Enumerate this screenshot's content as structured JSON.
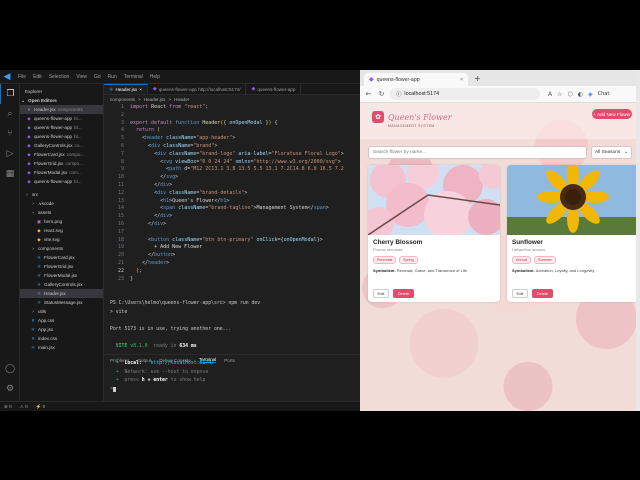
{
  "vscode": {
    "menu": [
      "File",
      "Edit",
      "Selection",
      "View",
      "Go",
      "Run",
      "Terminal",
      "Help"
    ],
    "explorer_title": "Explorer",
    "open_editors_label": "Open Editors",
    "open_editors": [
      {
        "name": "Header.jsx",
        "dim": "components",
        "selected": true
      },
      {
        "name": "queens-flower-app",
        "dim": "bl...",
        "selected": false
      },
      {
        "name": "queens-flower-app",
        "dim": "bl...",
        "selected": false
      },
      {
        "name": "queens-flower-app",
        "dim": "bl...",
        "selected": false
      },
      {
        "name": "GalleryControls.jsx",
        "dim": "co...",
        "selected": false
      },
      {
        "name": "FlowerCard.jsx",
        "dim": "compo...",
        "selected": false
      },
      {
        "name": "FlowerGrid.jsx",
        "dim": "compo...",
        "selected": false
      },
      {
        "name": "FlowerModal.jsx",
        "dim": "com...",
        "selected": false
      },
      {
        "name": "queens-flower-app",
        "dim": "bl...",
        "selected": false
      }
    ],
    "project_tree": [
      {
        "name": "src",
        "type": "folder",
        "indent": 0,
        "selected": false
      },
      {
        "name": ".vscode",
        "type": "folder",
        "indent": 1,
        "selected": false
      },
      {
        "name": "assets",
        "type": "folder",
        "indent": 1,
        "selected": false
      },
      {
        "name": "hero.png",
        "type": "file",
        "indent": 2,
        "selected": false
      },
      {
        "name": "react.svg",
        "type": "file",
        "indent": 2,
        "selected": false
      },
      {
        "name": "vite.svg",
        "type": "file",
        "indent": 2,
        "selected": false
      },
      {
        "name": "components",
        "type": "folder",
        "indent": 1,
        "selected": false
      },
      {
        "name": "FlowerCard.jsx",
        "type": "file",
        "indent": 2,
        "selected": false
      },
      {
        "name": "FlowerGrid.jsx",
        "type": "file",
        "indent": 2,
        "selected": false
      },
      {
        "name": "FlowerModal.jsx",
        "type": "file",
        "indent": 2,
        "selected": false
      },
      {
        "name": "GalleryControls.jsx",
        "type": "file",
        "indent": 2,
        "selected": false
      },
      {
        "name": "Header.jsx",
        "type": "file",
        "indent": 2,
        "selected": true
      },
      {
        "name": "StatusMessage.jsx",
        "type": "file",
        "indent": 2,
        "selected": false
      },
      {
        "name": "utils",
        "type": "folder",
        "indent": 1,
        "selected": false
      },
      {
        "name": "App.css",
        "type": "file",
        "indent": 1,
        "selected": false
      },
      {
        "name": "App.jsx",
        "type": "file",
        "indent": 1,
        "selected": false
      },
      {
        "name": "index.css",
        "type": "file",
        "indent": 1,
        "selected": false
      },
      {
        "name": "main.jsx",
        "type": "file",
        "indent": 1,
        "selected": false
      }
    ],
    "tabs": [
      {
        "label": "Header.jsx",
        "active": true
      },
      {
        "label": "queens-flower-app http://localhost:5174/",
        "active": false
      },
      {
        "label": "queens-flower-app",
        "active": false
      }
    ],
    "breadcrumbs": [
      "components",
      ">",
      "Header.jsx",
      ">",
      "Header"
    ],
    "code_lines": [
      {
        "n": "1",
        "t": [
          [
            "kw",
            "import "
          ],
          [
            "ct",
            "React "
          ],
          [
            "kw",
            "from "
          ],
          [
            "st",
            "\"react\""
          ],
          [
            "ct",
            ";"
          ]
        ]
      },
      {
        "n": "2",
        "t": []
      },
      {
        "n": "3",
        "t": [
          [
            "kw",
            "export default "
          ],
          [
            "kb",
            "function "
          ],
          [
            "fn",
            "Header"
          ],
          [
            "br",
            "("
          ],
          [
            "ct",
            "{ "
          ],
          [
            "at",
            "onOpenModal"
          ],
          [
            "ct",
            " }"
          ],
          [
            "br",
            ")"
          ],
          [
            "ct",
            " {"
          ]
        ]
      },
      {
        "n": "4",
        "t": [
          [
            "ct",
            "  "
          ],
          [
            "kw",
            "return "
          ],
          [
            "br",
            "("
          ]
        ]
      },
      {
        "n": "5",
        "t": [
          [
            "ct",
            "    <"
          ],
          [
            "tg",
            "header "
          ],
          [
            "at",
            "className"
          ],
          [
            "ct",
            "="
          ],
          [
            "st",
            "\"app-header\""
          ],
          [
            "ct",
            ">"
          ]
        ]
      },
      {
        "n": "6",
        "t": [
          [
            "ct",
            "      <"
          ],
          [
            "tg",
            "div "
          ],
          [
            "at",
            "className"
          ],
          [
            "ct",
            "="
          ],
          [
            "st",
            "\"brand\""
          ],
          [
            "ct",
            ">"
          ]
        ]
      },
      {
        "n": "7",
        "t": [
          [
            "ct",
            "        <"
          ],
          [
            "tg",
            "div "
          ],
          [
            "at",
            "className"
          ],
          [
            "ct",
            "="
          ],
          [
            "st",
            "\"brand-logo\" "
          ],
          [
            "at",
            "aria-label"
          ],
          [
            "ct",
            "="
          ],
          [
            "st",
            "\"Floratuse Floral Logo\""
          ],
          [
            "ct",
            ">"
          ]
        ]
      },
      {
        "n": "8",
        "t": [
          [
            "ct",
            "          <"
          ],
          [
            "tg",
            "svg "
          ],
          [
            "at",
            "viewBox"
          ],
          [
            "ct",
            "="
          ],
          [
            "st",
            "\"0 0 24 24\" "
          ],
          [
            "at",
            "xmlns"
          ],
          [
            "ct",
            "="
          ],
          [
            "st",
            "\"http://www.w3.org/2000/svg\""
          ],
          [
            "ct",
            ">"
          ]
        ]
      },
      {
        "n": "9",
        "t": [
          [
            "ct",
            "            <"
          ],
          [
            "tg",
            "path "
          ],
          [
            "at",
            "d"
          ],
          [
            "ct",
            "="
          ],
          [
            "st",
            "\"M12 2C13.1 3.8 13.5 5.5 13.1 7.2C14.8 6.0 16.5 7.2"
          ]
        ]
      },
      {
        "n": "10",
        "t": [
          [
            "ct",
            "          </"
          ],
          [
            "tg",
            "svg"
          ],
          [
            "ct",
            ">"
          ]
        ]
      },
      {
        "n": "11",
        "t": [
          [
            "ct",
            "        </"
          ],
          [
            "tg",
            "div"
          ],
          [
            "ct",
            ">"
          ]
        ]
      },
      {
        "n": "12",
        "t": [
          [
            "ct",
            "        <"
          ],
          [
            "tg",
            "div "
          ],
          [
            "at",
            "className"
          ],
          [
            "ct",
            "="
          ],
          [
            "st",
            "\"brand-details\""
          ],
          [
            "ct",
            ">"
          ]
        ]
      },
      {
        "n": "13",
        "t": [
          [
            "ct",
            "          <"
          ],
          [
            "tg",
            "h1"
          ],
          [
            "ct",
            ">"
          ],
          [
            "tx",
            "Queen's Flower"
          ],
          [
            "ct",
            "</"
          ],
          [
            "tg",
            "h1"
          ],
          [
            "ct",
            ">"
          ]
        ]
      },
      {
        "n": "14",
        "t": [
          [
            "ct",
            "          <"
          ],
          [
            "tg",
            "span "
          ],
          [
            "at",
            "className"
          ],
          [
            "ct",
            "="
          ],
          [
            "st",
            "\"brand-tagline\""
          ],
          [
            "ct",
            ">"
          ],
          [
            "tx",
            "Management System"
          ],
          [
            "ct",
            "</"
          ],
          [
            "tg",
            "span"
          ],
          [
            "ct",
            ">"
          ]
        ]
      },
      {
        "n": "15",
        "t": [
          [
            "ct",
            "        </"
          ],
          [
            "tg",
            "div"
          ],
          [
            "ct",
            ">"
          ]
        ]
      },
      {
        "n": "16",
        "t": [
          [
            "ct",
            "      </"
          ],
          [
            "tg",
            "div"
          ],
          [
            "ct",
            ">"
          ]
        ]
      },
      {
        "n": "17",
        "t": []
      },
      {
        "n": "18",
        "t": [
          [
            "ct",
            "      <"
          ],
          [
            "tg",
            "button "
          ],
          [
            "at",
            "className"
          ],
          [
            "ct",
            "="
          ],
          [
            "st",
            "\"btn btn-primary\" "
          ],
          [
            "at",
            "onClick"
          ],
          [
            "ct",
            "={"
          ],
          [
            "at",
            "onOpenModal"
          ],
          [
            "ct",
            "}>"
          ]
        ]
      },
      {
        "n": "19",
        "t": [
          [
            "tx",
            "        + Add New Flower"
          ]
        ]
      },
      {
        "n": "20",
        "t": [
          [
            "ct",
            "      </"
          ],
          [
            "tg",
            "button"
          ],
          [
            "ct",
            ">"
          ]
        ]
      },
      {
        "n": "21",
        "t": [
          [
            "ct",
            "    </"
          ],
          [
            "tg",
            "header"
          ],
          [
            "ct",
            ">"
          ]
        ]
      },
      {
        "n": "22",
        "t": [
          [
            "ct",
            "  "
          ],
          [
            "br",
            ")"
          ],
          [
            "ct",
            ";"
          ]
        ]
      },
      {
        "n": "23",
        "t": [
          [
            "ct",
            "}"
          ]
        ]
      }
    ],
    "panel_tabs": [
      "Problems",
      "Output",
      "Debug Console",
      "Terminal",
      "Ports"
    ],
    "terminal": {
      "prompt": "PS C:\\Users\\helmo\\queens-flower-app\\src> npm run dev",
      "cmd": "> vite",
      "port_msg": "Port 5173 is in use, trying another one...",
      "vite_label": "VITE",
      "vite_version": "v8.1.0",
      "ready_text": "ready in",
      "ready_ms": "634 ms",
      "local_label": "Local:",
      "local_url": "http://localhost:5174/",
      "network_label": "Network:",
      "network_text": "use --host to expose",
      "help_prefix": "press",
      "help_key": "h + enter",
      "help_suffix": "to show help"
    },
    "status_items": [
      "⊗ 0",
      "⚠ 0",
      "⚡ 0"
    ]
  },
  "browser": {
    "tab_title": "queens-flower-app",
    "url": "localhost:5174",
    "copilot_label": "Chat",
    "app": {
      "brand_title": "Queen's Flower",
      "brand_tagline": "MANAGEMENT SYSTEM",
      "add_button": "+ Add New Flower",
      "search_placeholder": "Search flower by name...",
      "season_select": "All Seasons",
      "cards": [
        {
          "name": "Cherry Blossom",
          "scientific": "Prunus serrulata",
          "tags": [
            "Perennial",
            "Spring"
          ],
          "symbolism_label": "Symbolism:",
          "symbolism": "Renewal, Grace, and Transience of Life",
          "edit": "Edit",
          "delete": "Delete"
        },
        {
          "name": "Sunflower",
          "scientific": "Helianthus annuus",
          "tags": [
            "Annual",
            "Summer"
          ],
          "symbolism_label": "Symbolism:",
          "symbolism": "Adoration, Loyalty, and Longevity",
          "edit": "Edit",
          "delete": "Delete"
        }
      ]
    }
  },
  "colors": {
    "vscode_accent": "#0078d4",
    "app_primary": "#e24b6b",
    "vite_green": "#22c55e"
  }
}
